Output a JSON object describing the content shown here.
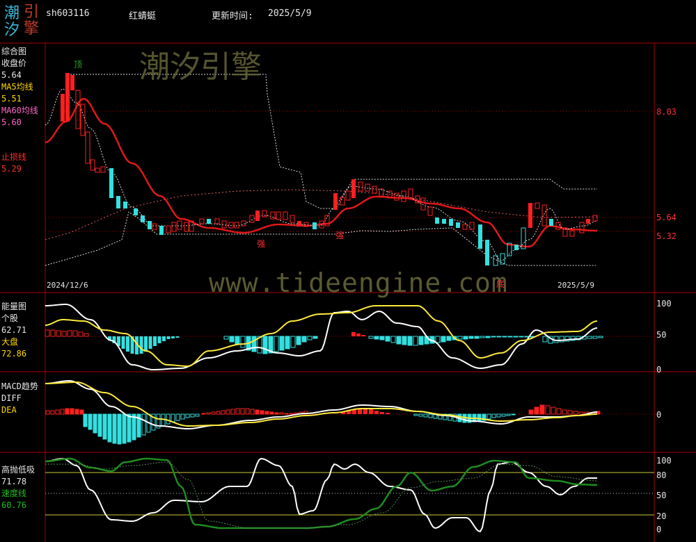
{
  "header": {
    "logo": {
      "chars": [
        "潮",
        "引",
        "汐",
        "擎"
      ],
      "colors": [
        "#3fb7d9",
        "#c0392b",
        "#3fb7d9",
        "#c0392b"
      ]
    },
    "code": "sh603116",
    "name": "红蜻蜓",
    "update_label": "更新时间:",
    "update_date": "2025/5/9"
  },
  "watermark": {
    "brand": "潮汐引擎",
    "url": "www.tideengine.com"
  },
  "panel_main": {
    "title": "综合图",
    "close_label": "收盘价",
    "close_value": "5.64",
    "ma5_label": "MA5均线",
    "ma5_value": "5.51",
    "ma60_label": "MA60均线",
    "ma60_value": "5.60",
    "stop_label": "止损线",
    "stop_value": "5.29",
    "right_labels": [
      "8.03",
      "5.64",
      "5.32"
    ],
    "start_date": "2024/12/6",
    "end_date": "2025/5/9",
    "marks": {
      "top": "顶",
      "strong1": "强",
      "strong2": "强",
      "bottom": "底"
    }
  },
  "panel_energy": {
    "title": "能量图",
    "stock_label": "个股",
    "stock_value": "62.71",
    "market_label": "大盘",
    "market_value": "72.86",
    "scale": [
      "100",
      "50",
      "0"
    ]
  },
  "panel_macd": {
    "title": "MACD趋势",
    "diff_label": "DIFF",
    "dea_label": "DEA",
    "scale": [
      "0"
    ]
  },
  "panel_kdj": {
    "title": "高抛低吸",
    "value1": "71.78",
    "speed_label": "速度线",
    "speed_value": "60.76",
    "scale": [
      "100",
      "80",
      "50",
      "20",
      "0"
    ]
  },
  "colors": {
    "up": "#ff2020",
    "down": "#33e0e0",
    "ma": "#e01818",
    "ma60": "#e06060",
    "white": "#ffffff",
    "yellow": "#ffeb3b",
    "green": "#1e8c1e",
    "grid": "#b00000",
    "label_yellow": "#ffd700",
    "label_pink": "#ff66cc"
  }
}
